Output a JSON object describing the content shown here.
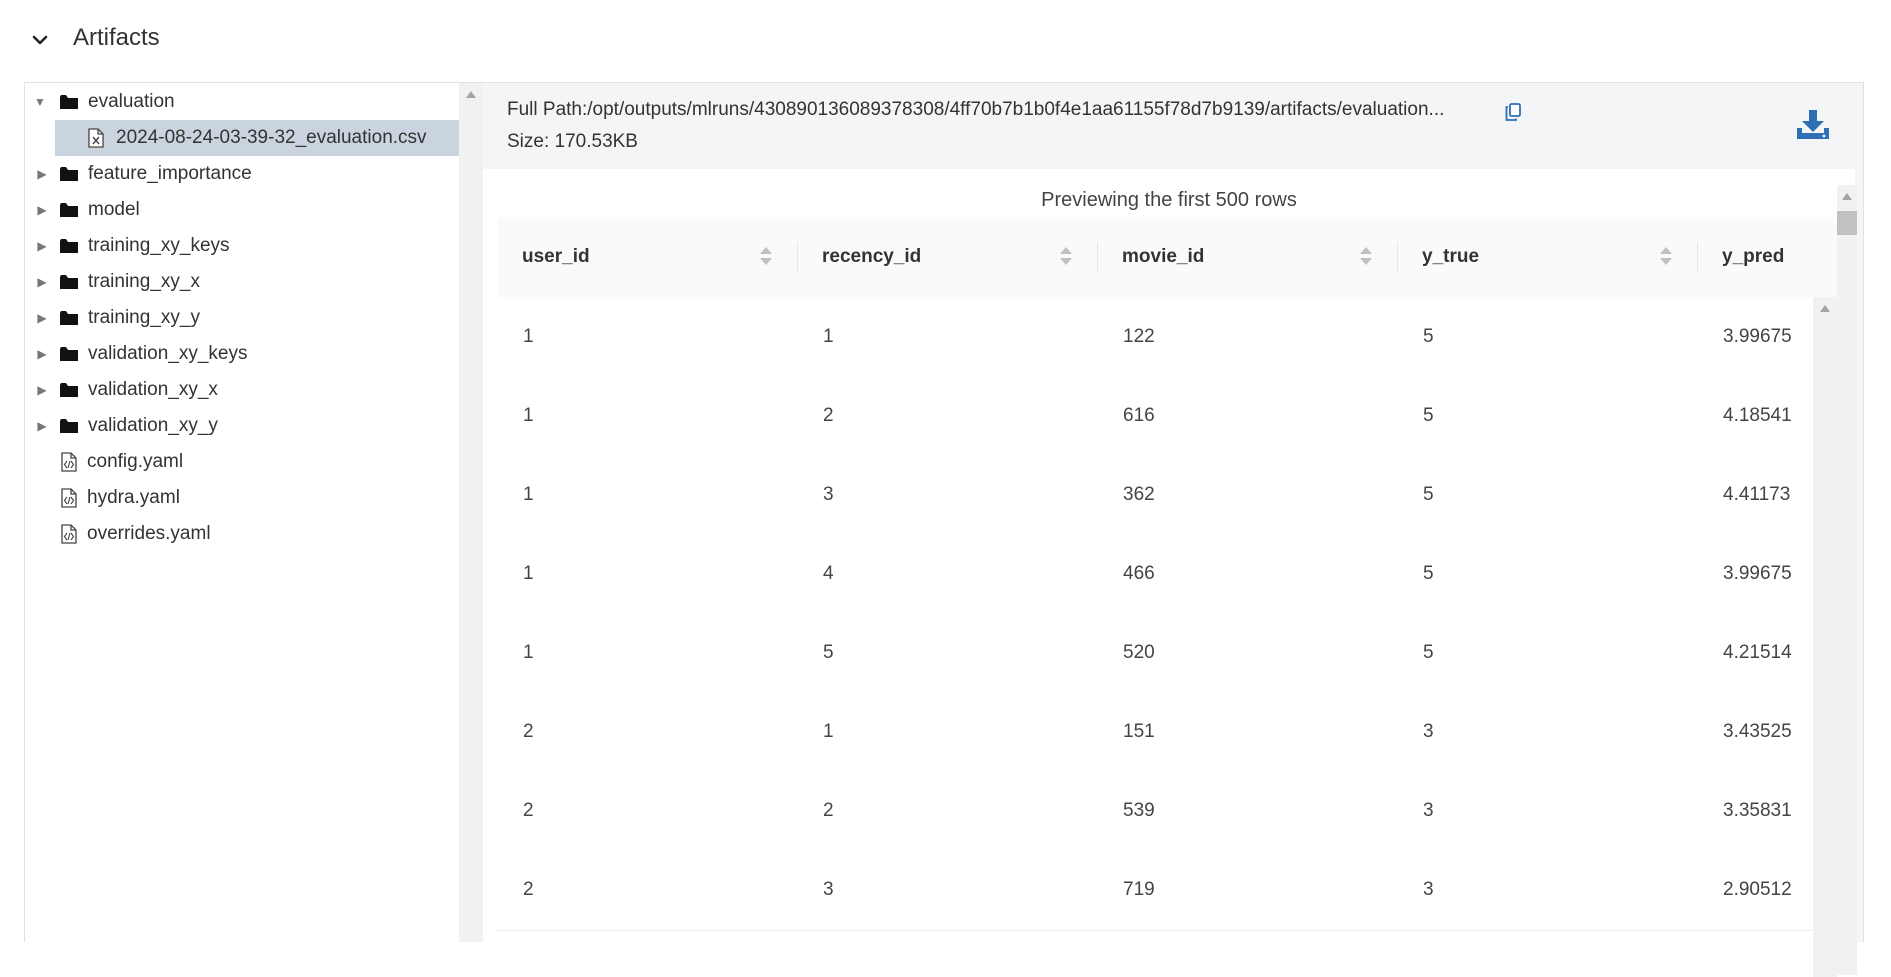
{
  "section": {
    "title": "Artifacts",
    "chevron_icon": "chevron-down-icon"
  },
  "tree": {
    "items": [
      {
        "label": "evaluation",
        "kind": "folder",
        "expanded": true
      },
      {
        "label": "2024-08-24-03-39-32_evaluation.csv",
        "kind": "csv-file",
        "selected": true
      },
      {
        "label": "feature_importance",
        "kind": "folder"
      },
      {
        "label": "model",
        "kind": "folder"
      },
      {
        "label": "training_xy_keys",
        "kind": "folder"
      },
      {
        "label": "training_xy_x",
        "kind": "folder"
      },
      {
        "label": "training_xy_y",
        "kind": "folder"
      },
      {
        "label": "validation_xy_keys",
        "kind": "folder"
      },
      {
        "label": "validation_xy_x",
        "kind": "folder"
      },
      {
        "label": "validation_xy_y",
        "kind": "folder"
      },
      {
        "label": "config.yaml",
        "kind": "code-file"
      },
      {
        "label": "hydra.yaml",
        "kind": "code-file"
      },
      {
        "label": "overrides.yaml",
        "kind": "code-file"
      }
    ]
  },
  "viewer": {
    "full_path": "Full Path:/opt/outputs/mlruns/430890136089378308/4ff70b7b1b0f4e1aa61155f78d7b9139/artifacts/evaluation...",
    "size": "Size: 170.53KB",
    "preview_text": "Previewing the first 500 rows",
    "copy_icon": "copy-icon",
    "download_icon": "download-icon"
  },
  "table": {
    "columns": [
      "user_id",
      "recency_id",
      "movie_id",
      "y_true",
      "y_pred"
    ],
    "rows": [
      [
        "1",
        "1",
        "122",
        "5",
        "3.99675"
      ],
      [
        "1",
        "2",
        "616",
        "5",
        "4.18541"
      ],
      [
        "1",
        "3",
        "362",
        "5",
        "4.41173"
      ],
      [
        "1",
        "4",
        "466",
        "5",
        "3.99675"
      ],
      [
        "1",
        "5",
        "520",
        "5",
        "4.21514"
      ],
      [
        "2",
        "1",
        "151",
        "3",
        "3.43525"
      ],
      [
        "2",
        "2",
        "539",
        "3",
        "3.35831"
      ],
      [
        "2",
        "3",
        "719",
        "3",
        "2.90512"
      ]
    ]
  },
  "colors": {
    "selected_row": "#c9d4de",
    "accent_blue": "#2f6fb5"
  }
}
